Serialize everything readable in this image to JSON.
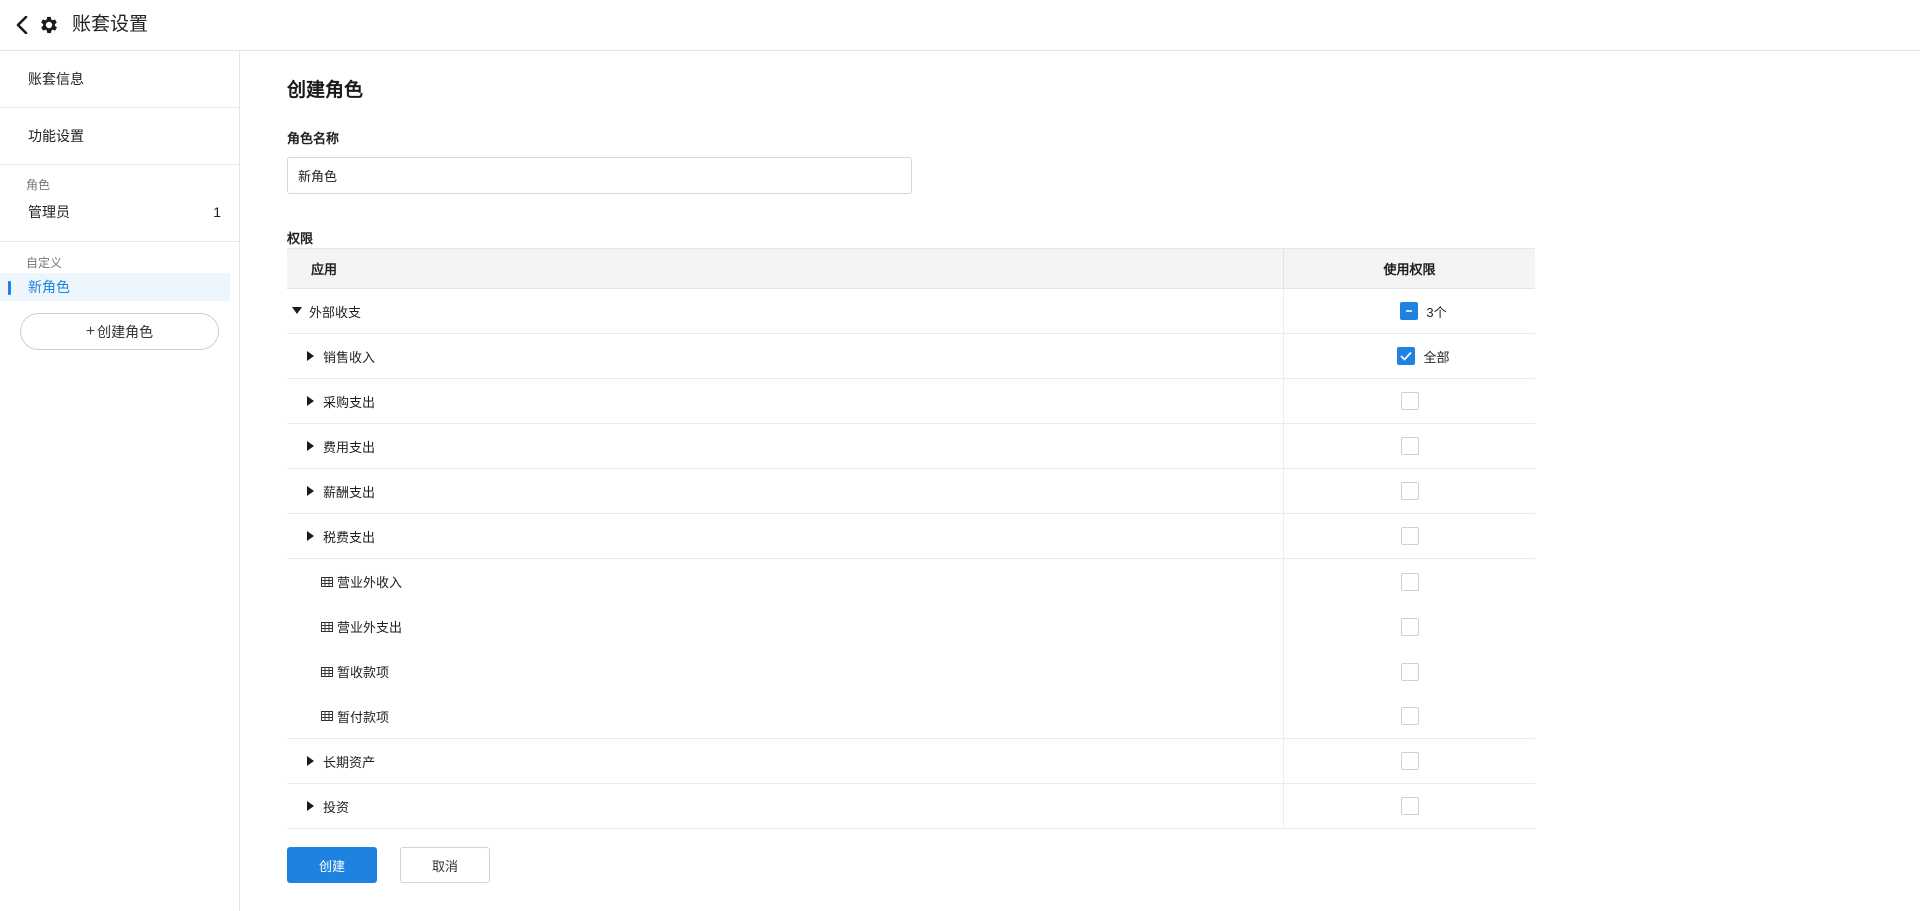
{
  "header": {
    "title": "账套设置",
    "back_icon": "chevron-left-icon",
    "settings_icon": "gear-icon"
  },
  "sidebar": {
    "items": [
      {
        "label": "账套信息"
      },
      {
        "label": "功能设置"
      }
    ],
    "roles_section": {
      "label": "角色",
      "roles": [
        {
          "label": "管理员",
          "count": "1"
        }
      ]
    },
    "custom_section": {
      "label": "自定义",
      "roles": [
        {
          "label": "新角色"
        }
      ]
    },
    "create_role": {
      "plus": "+",
      "label": "创建角色"
    }
  },
  "main": {
    "title": "创建角色",
    "role_name_label": "角色名称",
    "role_name_value": "新角色",
    "permissions_label": "权限",
    "table": {
      "col_app": "应用",
      "col_perm": "使用权限",
      "rows": [
        {
          "label": "外部收支",
          "state": "partial",
          "perm_text": "3个"
        },
        {
          "label": "销售收入",
          "state": "checked",
          "perm_text": "全部"
        },
        {
          "label": "采购支出",
          "state": "unchecked"
        },
        {
          "label": "费用支出",
          "state": "unchecked"
        },
        {
          "label": "薪酬支出",
          "state": "unchecked"
        },
        {
          "label": "税费支出",
          "state": "unchecked"
        },
        {
          "label": "营业外收入",
          "state": "unchecked"
        },
        {
          "label": "营业外支出",
          "state": "unchecked"
        },
        {
          "label": "暂收款项",
          "state": "unchecked"
        },
        {
          "label": "暂付款项",
          "state": "unchecked"
        },
        {
          "label": "长期资产",
          "state": "unchecked"
        },
        {
          "label": "投资",
          "state": "unchecked"
        }
      ]
    },
    "buttons": {
      "create": "创建",
      "cancel": "取消"
    }
  },
  "colors": {
    "accent": "#1d82e0",
    "border": "#e4e4e4",
    "header_bg": "#f4f4f4"
  }
}
